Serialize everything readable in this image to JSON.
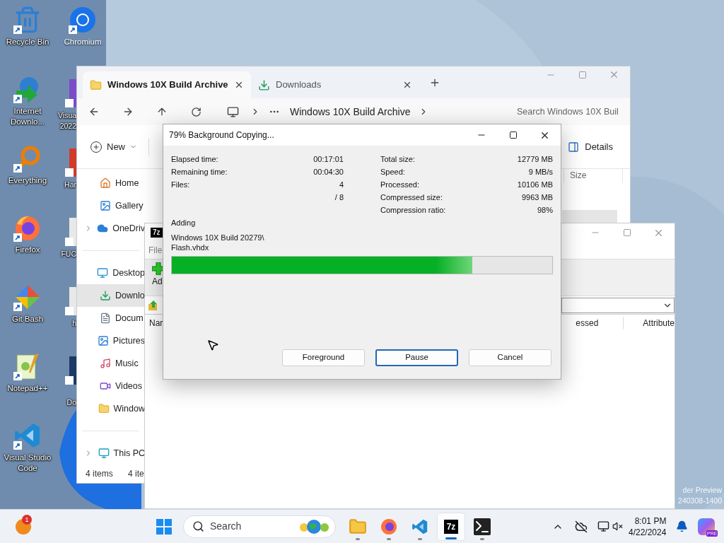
{
  "desktop_icons": [
    {
      "label": "Recycle Bin"
    },
    {
      "label": "Internet Downlo..."
    },
    {
      "label": "Everything"
    },
    {
      "label": "Firefox"
    },
    {
      "label": "Git Bash"
    },
    {
      "label": "Notepad++"
    },
    {
      "label": "Visual Studio Code"
    }
  ],
  "desktop_icons_2": [
    {
      "label": "Chromium"
    },
    {
      "label": "Visua 2022"
    },
    {
      "label": "Har"
    },
    {
      "label": "FUC"
    },
    {
      "label": "h"
    },
    {
      "label": "Do"
    }
  ],
  "explorer": {
    "tabs": [
      {
        "label": "Windows 10X Build Archive",
        "selected": true
      },
      {
        "label": "Downloads",
        "selected": false
      }
    ],
    "address": "Windows 10X Build Archive",
    "search_placeholder": "Search Windows 10X Buil",
    "new_label": "New",
    "details_label": "Details",
    "column": "Size",
    "sidebar": [
      {
        "label": "Home",
        "selected": false,
        "expandable": false
      },
      {
        "label": "Gallery",
        "selected": false,
        "expandable": false
      },
      {
        "label": "OneDriv",
        "selected": false,
        "expandable": true
      },
      {
        "label": "Desktop",
        "selected": false,
        "expandable": false
      },
      {
        "label": "Downlo",
        "selected": true,
        "expandable": false
      },
      {
        "label": "Docum",
        "selected": false,
        "expandable": false
      },
      {
        "label": "Pictures",
        "selected": false,
        "expandable": false
      },
      {
        "label": "Music",
        "selected": false,
        "expandable": false
      },
      {
        "label": "Videos",
        "selected": false,
        "expandable": false
      },
      {
        "label": "Window",
        "selected": false,
        "expandable": false
      },
      {
        "label": "This PC",
        "selected": false,
        "expandable": true
      }
    ],
    "status": "4 items",
    "status_2": "4 ite"
  },
  "sevenzip": {
    "icon_text": "7z",
    "menu": "File",
    "add_label": "Ad",
    "columns": [
      "Nar",
      "essed",
      "Attribute"
    ]
  },
  "dialog": {
    "title": "79% Background Copying...",
    "left_stats": [
      {
        "label": "Elapsed time:",
        "value": "00:17:01"
      },
      {
        "label": "Remaining time:",
        "value": "00:04:30"
      },
      {
        "label": "Files:",
        "value": "4"
      },
      {
        "value": "/ 8"
      }
    ],
    "right_stats": [
      {
        "label": "Total size:",
        "value": "12779 MB"
      },
      {
        "label": "Speed:",
        "value": "9 MB/s"
      },
      {
        "label": "Processed:",
        "value": "10106 MB"
      },
      {
        "label": "Compressed size:",
        "value": "9963 MB"
      },
      {
        "label": "Compression ratio:",
        "value": "98%"
      }
    ],
    "action": "Adding",
    "file_path": "Windows 10X Build 20279\\ Flash.vhdx",
    "progress": {
      "level": 0.79
    },
    "buttons": [
      {
        "label": "Foreground",
        "focused": false
      },
      {
        "label": "Pause",
        "focused": true
      },
      {
        "label": "Cancel",
        "focused": false
      }
    ]
  },
  "watermark": [
    "der Preview",
    "240308-1400"
  ],
  "taskbar": {
    "weather_badge": "1",
    "search_placeholder": "Search",
    "apps": [
      {
        "selected": false
      },
      {
        "selected": false
      },
      {
        "selected": false
      },
      {
        "selected": true,
        "text": "7z"
      },
      {
        "selected": false
      }
    ],
    "time": "8:01 PM",
    "date": "4/22/2024",
    "copilot_badge": "PRE"
  }
}
